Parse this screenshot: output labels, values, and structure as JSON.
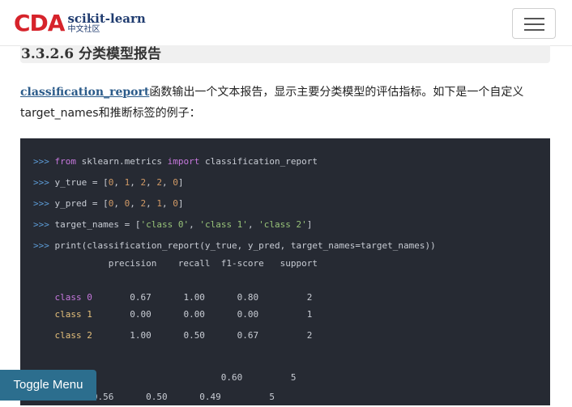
{
  "navbar": {
    "logo_cda": "CDA",
    "logo_main": "scikit-learn",
    "logo_sub": "中文社区"
  },
  "section": {
    "title": "3.3.2.6 分类模型报告"
  },
  "paragraph": {
    "link": "classification_report",
    "text": "函数输出一个文本报告，显示主要分类模型的评估指标。如下是一个自定义target_names和推断标签的例子："
  },
  "code": {
    "prompt": ">>>",
    "lines": {
      "l1": {
        "kw1": "from",
        "mod": " sklearn.metrics ",
        "kw2": "import",
        "rest": " classification_report"
      },
      "l2": {
        "a": " y_true = [",
        "n1": "0",
        "c1": ", ",
        "n2": "1",
        "c2": ", ",
        "n3": "2",
        "c3": ", ",
        "n4": "2",
        "c4": ", ",
        "n5": "0",
        "e": "]"
      },
      "l3": {
        "a": " y_pred = [",
        "n1": "0",
        "c1": ", ",
        "n2": "0",
        "c2": ", ",
        "n3": "2",
        "c3": ", ",
        "n4": "1",
        "c4": ", ",
        "n5": "0",
        "e": "]"
      },
      "l4": {
        "a": " target_names = [",
        "s1": "'class 0'",
        "c1": ", ",
        "s2": "'class 1'",
        "c2": ", ",
        "s3": "'class 2'",
        "e": "]"
      },
      "l5": {
        "a": " print(classification_report(y_true, y_pred, target_names=target_names))"
      }
    },
    "output": {
      "header": "              precision    recall  f1-score   support",
      "rows": [
        {
          "label": "class 0",
          "values": "       0.67      1.00      0.80         2"
        },
        {
          "label": "class 1",
          "values": "       0.00      0.00      0.00         1"
        },
        {
          "label": "class 2",
          "values": "       1.00      0.50      0.67         2"
        }
      ],
      "accuracy": "                                   0.60         5",
      "partial": "           0.56      0.50      0.49         5"
    }
  },
  "toggle_menu": "Toggle Menu"
}
